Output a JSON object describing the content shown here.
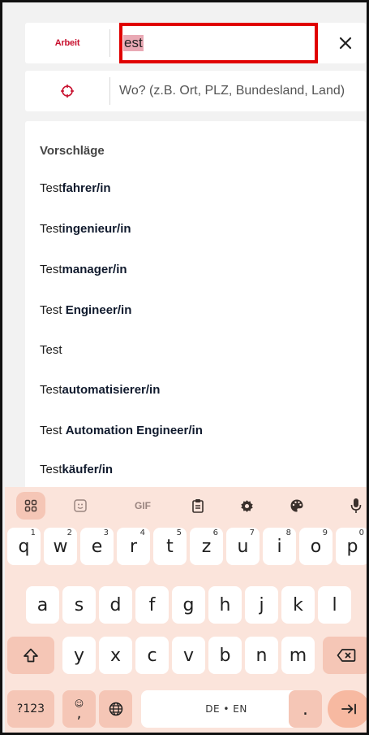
{
  "search": {
    "category_chip": "Arbeit",
    "what_value": "est",
    "where_placeholder": "Wo? (z.B. Ort, PLZ, Bundesland, Land)"
  },
  "suggestions": {
    "heading": "Vorschläge",
    "items": [
      {
        "prefix": "Test",
        "rest": "fahrer/in"
      },
      {
        "prefix": "Test",
        "rest": "ingenieur/in"
      },
      {
        "prefix": "Test",
        "rest": "manager/in"
      },
      {
        "prefix": "Test ",
        "rest": "Engineer/in"
      },
      {
        "prefix": "Test",
        "rest": ""
      },
      {
        "prefix": "Test",
        "rest": "automatisierer/in"
      },
      {
        "prefix": "Test ",
        "rest": "Automation Engineer/in"
      },
      {
        "prefix": "Test",
        "rest": "käufer/in"
      }
    ]
  },
  "keyboard": {
    "toolbar": {
      "gif_label": "GIF"
    },
    "row1": [
      {
        "key": "q",
        "hint": "1"
      },
      {
        "key": "w",
        "hint": "2"
      },
      {
        "key": "e",
        "hint": "3"
      },
      {
        "key": "r",
        "hint": "4"
      },
      {
        "key": "t",
        "hint": "5"
      },
      {
        "key": "z",
        "hint": "6"
      },
      {
        "key": "u",
        "hint": "7"
      },
      {
        "key": "i",
        "hint": "8"
      },
      {
        "key": "o",
        "hint": "9"
      },
      {
        "key": "p",
        "hint": "0"
      }
    ],
    "row2": [
      "a",
      "s",
      "d",
      "f",
      "g",
      "h",
      "j",
      "k",
      "l"
    ],
    "row3": [
      "y",
      "x",
      "c",
      "v",
      "b",
      "n",
      "m"
    ],
    "symbols_label": "?123",
    "comma_label": ",",
    "space_label": "DE • EN",
    "period_label": "."
  },
  "colors": {
    "highlight_border": "#e00000",
    "brand_red": "#c8102e",
    "keyboard_bg": "#fbe4db",
    "key_special": "#f5c6b6"
  }
}
